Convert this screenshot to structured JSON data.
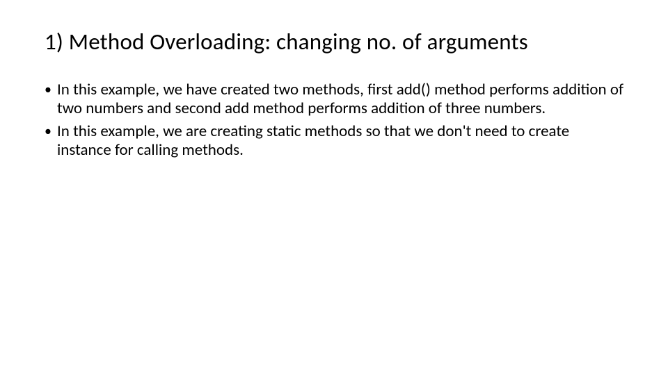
{
  "title": "1) Method Overloading: changing no. of arguments",
  "bullets": [
    "In this example, we have created two methods, first add() method performs addition of two numbers and second add method performs addition of three numbers.",
    "In this example, we are creating static methods so that we don't need to create instance for calling methods."
  ]
}
